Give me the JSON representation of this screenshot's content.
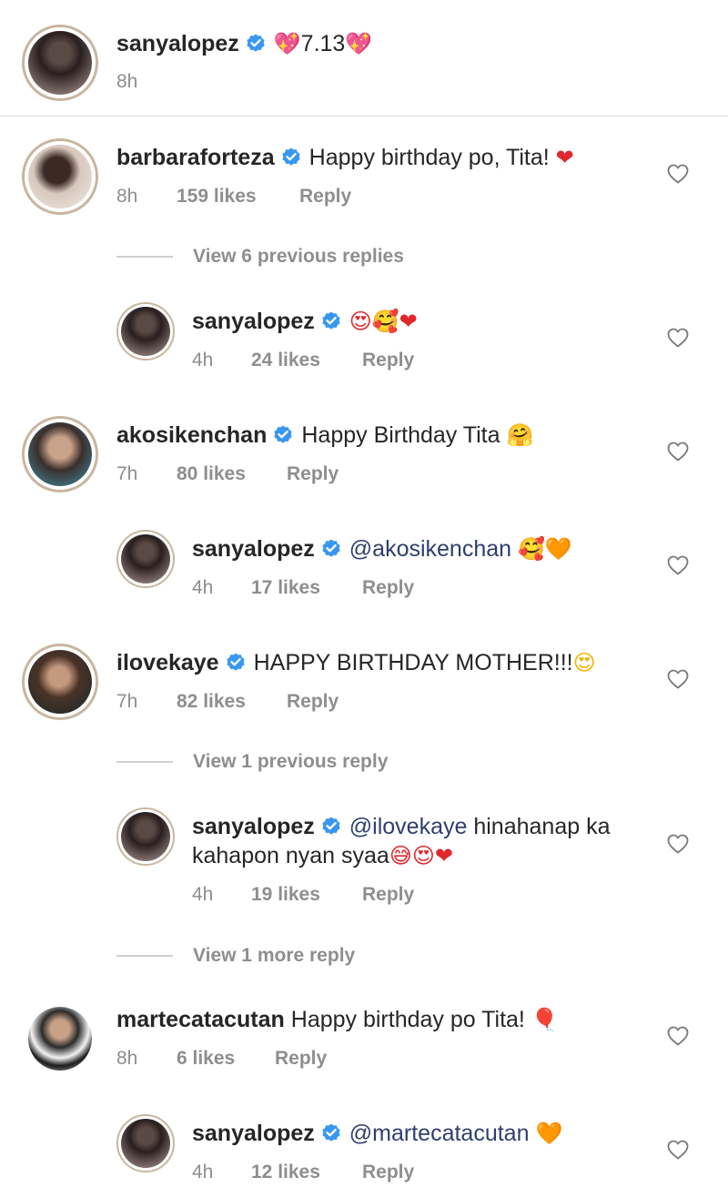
{
  "post": {
    "username": "sanyalopez",
    "caption_text": "7.13",
    "caption_emoji_left": "💖",
    "caption_emoji_right": "💖",
    "time": "8h"
  },
  "comments": [
    {
      "username": "barbaraforteza",
      "verified": true,
      "text": "Happy birthday po, Tita!",
      "emoji": "❤",
      "time": "8h",
      "likes": "159 likes",
      "reply_label": "Reply",
      "view_replies": "View 6 previous replies",
      "reply": {
        "username": "sanyalopez",
        "text": "",
        "emoji": "😍🥰❤",
        "time": "4h",
        "likes": "24 likes",
        "reply_label": "Reply"
      }
    },
    {
      "username": "akosikenchan",
      "verified": true,
      "text": "Happy Birthday Tita",
      "emoji": "🤗",
      "time": "7h",
      "likes": "80 likes",
      "reply_label": "Reply",
      "reply": {
        "username": "sanyalopez",
        "mention": "@akosikenchan",
        "emoji": "🥰🧡",
        "time": "4h",
        "likes": "17 likes",
        "reply_label": "Reply"
      }
    },
    {
      "username": "ilovekaye",
      "verified": true,
      "text": "HAPPY BIRTHDAY MOTHER!!!",
      "emoji": "😍",
      "time": "7h",
      "likes": "82 likes",
      "reply_label": "Reply",
      "view_replies": "View 1 previous reply",
      "reply": {
        "username": "sanyalopez",
        "mention": "@ilovekaye",
        "text_line1": "hinahanap ka",
        "text_line2": "kahapon nyan syaa",
        "emoji": "😅😍❤",
        "time": "4h",
        "likes": "19 likes",
        "reply_label": "Reply"
      },
      "view_more": "View 1 more reply"
    },
    {
      "username": "martecatacutan",
      "verified": false,
      "text": "Happy birthday po Tita!",
      "emoji": "🎈",
      "time": "8h",
      "likes": "6 likes",
      "reply_label": "Reply",
      "reply": {
        "username": "sanyalopez",
        "mention": "@martecatacutan",
        "emoji": "🧡",
        "time": "4h",
        "likes": "12 likes",
        "reply_label": "Reply"
      }
    }
  ],
  "icons": {
    "verified": "verified-badge-icon",
    "like": "heart-outline-icon"
  },
  "colors": {
    "verified_blue": "#3897f0",
    "meta_gray": "#8e8e8e",
    "mention_blue": "#2e3f6e"
  }
}
